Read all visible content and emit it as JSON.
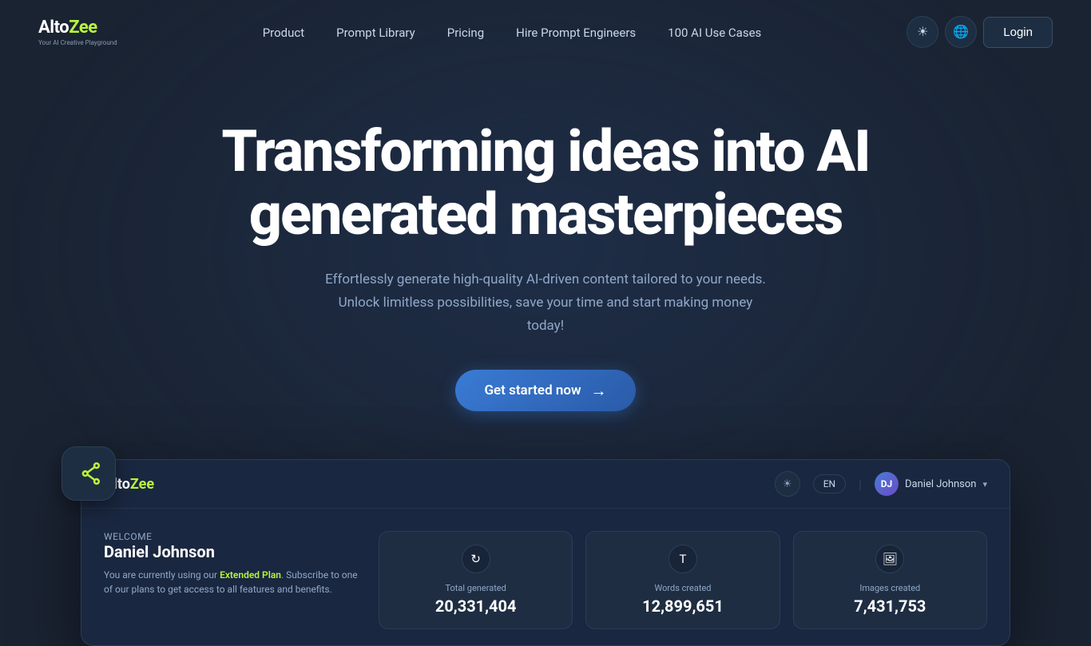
{
  "site": {
    "logo": {
      "alto": "Alto",
      "zee": "Zee",
      "tagline": "Your AI Creative Playground"
    }
  },
  "nav": {
    "links": [
      {
        "label": "Product",
        "href": "#"
      },
      {
        "label": "Prompt Library",
        "href": "#"
      },
      {
        "label": "Pricing",
        "href": "#"
      },
      {
        "label": "Hire Prompt Engineers",
        "href": "#"
      },
      {
        "label": "100 AI Use Cases",
        "href": "#"
      }
    ],
    "login_label": "Login",
    "theme_icon": "☀",
    "globe_icon": "🌐"
  },
  "hero": {
    "title_line1": "Transforming ideas into AI",
    "title_line2": "generated masterpieces",
    "subtitle": "Effortlessly generate high-quality AI-driven content tailored to your needs. Unlock limitless possibilities, save your time and start making money today!",
    "cta_label": "Get started now"
  },
  "dashboard": {
    "logo": {
      "alto": "Alto",
      "zee": "Zee"
    },
    "nav": {
      "theme_icon": "☀",
      "lang_label": "EN",
      "user": {
        "name": "Daniel Johnson",
        "initials": "DJ",
        "chevron": "▾"
      }
    },
    "welcome": {
      "label": "Welcome",
      "name": "Daniel Johnson",
      "plan_prefix": "You are currently using our ",
      "plan_name": "Extended Plan",
      "plan_suffix": ". Subscribe to one of our plans to get access to all features and benefits."
    },
    "stats": [
      {
        "icon": "↻",
        "label": "Total generated",
        "value": "20,331,404"
      },
      {
        "icon": "T",
        "label": "Words created",
        "value": "12,899,651"
      },
      {
        "icon": "🖼",
        "label": "Images created",
        "value": "7,431,753"
      }
    ]
  }
}
